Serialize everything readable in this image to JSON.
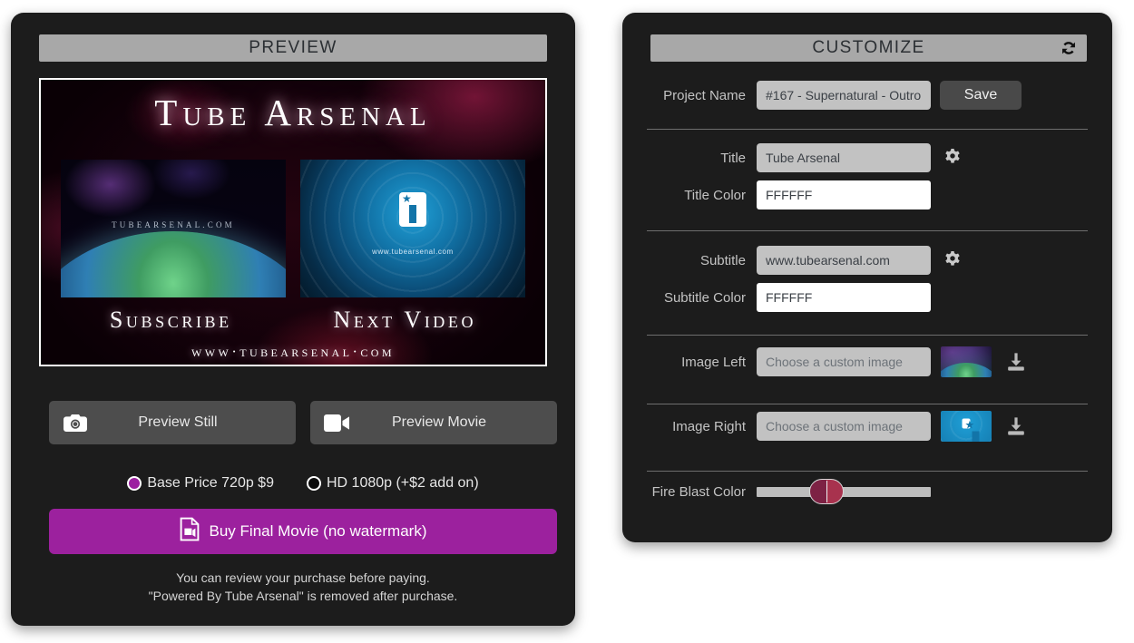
{
  "preview": {
    "header_title": "PREVIEW",
    "artwork": {
      "title": "Tube Arsenal",
      "left_thumb_label": "TUBEARSENAL.COM",
      "right_thumb_label": "www.tubearsenal.com",
      "left_caption": "Subscribe",
      "right_caption": "Next Video",
      "footer": "www·tubearsenal·com"
    },
    "buttons": {
      "preview_still": "Preview Still",
      "preview_movie": "Preview Movie",
      "buy": "Buy Final Movie (no watermark)"
    },
    "quality_options": [
      {
        "label": "Base Price 720p $9",
        "selected": true
      },
      {
        "label": "HD 1080p (+$2 add on)",
        "selected": false
      }
    ],
    "notes_line1": "You can review your purchase before paying.",
    "notes_line2": "\"Powered By Tube Arsenal\" is removed after purchase."
  },
  "customize": {
    "header_title": "CUSTOMIZE",
    "refresh_icon": "refresh-icon",
    "project": {
      "label": "Project Name",
      "value": "#167 - Supernatural - Outro",
      "save_label": "Save"
    },
    "rows": [
      {
        "label": "Title",
        "value": "Tube Arsenal",
        "placeholder": ""
      },
      {
        "label": "Title Color",
        "value": "FFFFFF",
        "placeholder": ""
      },
      {
        "label": "Subtitle",
        "value": "www.tubearsenal.com",
        "placeholder": ""
      },
      {
        "label": "Subtitle Color",
        "value": "FFFFFF",
        "placeholder": ""
      },
      {
        "label": "Image Left",
        "value": "",
        "placeholder": "Choose a custom image"
      },
      {
        "label": "Image Right",
        "value": "",
        "placeholder": "Choose a custom image"
      }
    ],
    "slider": {
      "label": "Fire Blast Color",
      "position_percent": 40
    }
  },
  "colors": {
    "panel_bg": "#1c1c1c",
    "header_bg": "#a8a8a8",
    "accent_purple": "#9c219e",
    "input_grey": "#c2c2c2",
    "input_white": "#FFFFFF",
    "slider_thumb_left": "#7d2244",
    "slider_thumb_right": "#a8324e"
  }
}
